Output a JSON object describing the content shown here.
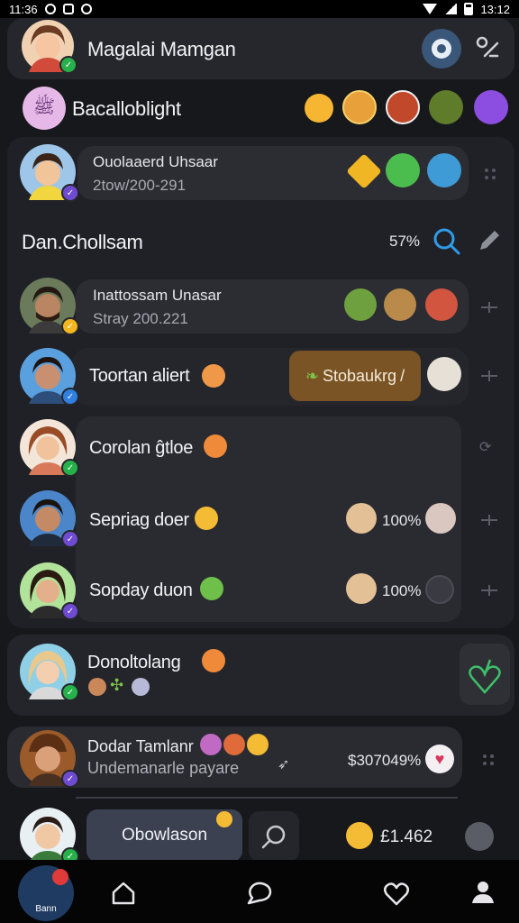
{
  "status": {
    "time_left": "11:36",
    "time_right": "13:12"
  },
  "header": {
    "title": "Magalai Mamgan"
  },
  "group": {
    "title": "Bacalloblight",
    "avatar_text": "ﷺ"
  },
  "featured": {
    "name": "Ouolaaerd Uhsaar",
    "meta": "2tow/200-291"
  },
  "section": {
    "title": "Dan.Chollsam",
    "percent": "57%"
  },
  "rows": [
    {
      "name": "Inattossam Unasar",
      "meta": "Stray 200.221"
    },
    {
      "name": "Toortan aliert",
      "action": "Stobaukrg"
    },
    {
      "name": "Corolan ĝtloe"
    },
    {
      "name": "Sepriag doer",
      "value": "100%"
    },
    {
      "name": "Sopday duon",
      "value": "100%"
    }
  ],
  "donoltolang": {
    "name": "Donoltolang"
  },
  "dodar": {
    "name": "Dodar Tamlanr",
    "sub": "Undemanarle payare",
    "amount": "$307049%"
  },
  "composer": {
    "button": "Obowlason",
    "amount": "£1.462"
  },
  "nav": {
    "profile_label": "Bann"
  },
  "colors": {
    "background": "#17181c",
    "card": "#26272d",
    "accent_green": "#27b14b",
    "accent_purple": "#6f4bd1",
    "action_brown": "#7a5424"
  }
}
